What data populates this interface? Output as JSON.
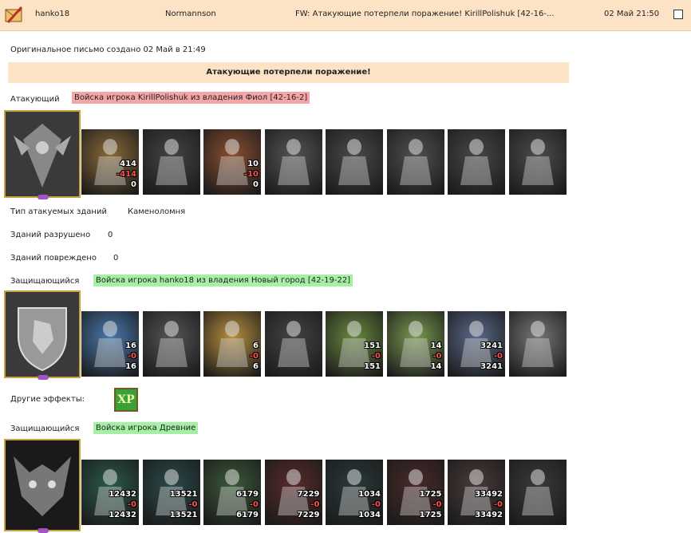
{
  "header": {
    "sender": "hanko18",
    "recipient": "Normannson",
    "subject": "FW: Атакующие потерпели поражение! KirillPolishuk [42-16-...",
    "date": "02 Май 21:50"
  },
  "original_created": "Оригинальное письмо создано 02 Май в 21:49",
  "banner": "Атакующие потерпели поражение!",
  "attacker": {
    "label": "Атакующий",
    "troops": "Войска игрока KirillPolishuk из владения Фиол [42-16-2]",
    "units": [
      {
        "n1": "414",
        "n2": "-414",
        "n3": "0"
      },
      {
        "n1": "",
        "n2": "",
        "n3": ""
      },
      {
        "n1": "10",
        "n2": "-10",
        "n3": "0"
      },
      {
        "n1": "",
        "n2": "",
        "n3": ""
      },
      {
        "n1": "",
        "n2": "",
        "n3": ""
      },
      {
        "n1": "",
        "n2": "",
        "n3": ""
      },
      {
        "n1": "",
        "n2": "",
        "n3": ""
      },
      {
        "n1": "",
        "n2": "",
        "n3": ""
      }
    ]
  },
  "buildings": {
    "type_label": "Тип атакуемых зданий",
    "type_value": "Каменоломня",
    "destroyed_label": "Зданий разрушено",
    "destroyed_value": "0",
    "damaged_label": "Зданий повреждено",
    "damaged_value": "0"
  },
  "defender1": {
    "label": "Защищающийся",
    "troops": "Войска игрока hanko18 из владения Новый город [42-19-22]",
    "units": [
      {
        "n1": "16",
        "n2": "-0",
        "n3": "16"
      },
      {
        "n1": "",
        "n2": "",
        "n3": ""
      },
      {
        "n1": "6",
        "n2": "-0",
        "n3": "6"
      },
      {
        "n1": "",
        "n2": "",
        "n3": ""
      },
      {
        "n1": "151",
        "n2": "-0",
        "n3": "151"
      },
      {
        "n1": "14",
        "n2": "-0",
        "n3": "14"
      },
      {
        "n1": "3241",
        "n2": "-0",
        "n3": "3241"
      },
      {
        "n1": "",
        "n2": "",
        "n3": ""
      }
    ]
  },
  "effects": {
    "label": "Другие эффекты:",
    "xp": "XP"
  },
  "defender2": {
    "label": "Защищающийся",
    "troops": "Войска игрока Древние",
    "units": [
      {
        "n1": "12432",
        "n2": "-0",
        "n3": "12432"
      },
      {
        "n1": "13521",
        "n2": "-0",
        "n3": "13521"
      },
      {
        "n1": "6179",
        "n2": "-0",
        "n3": "6179"
      },
      {
        "n1": "7229",
        "n2": "-0",
        "n3": "7229"
      },
      {
        "n1": "1034",
        "n2": "-0",
        "n3": "1034"
      },
      {
        "n1": "1725",
        "n2": "-0",
        "n3": "1725"
      },
      {
        "n1": "33492",
        "n2": "-0",
        "n3": "33492"
      },
      {
        "n1": "",
        "n2": "",
        "n3": ""
      }
    ]
  }
}
